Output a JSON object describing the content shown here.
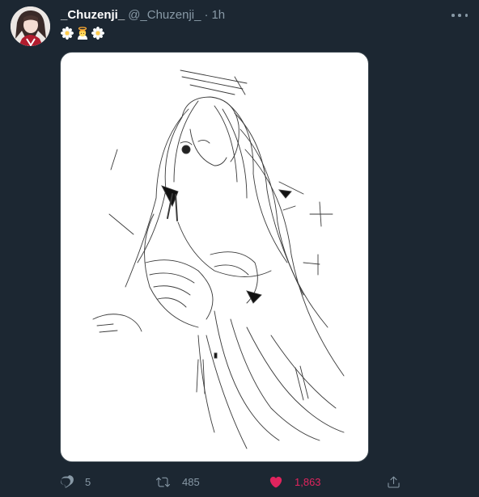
{
  "tweet": {
    "display_name": "_Chuzenji_",
    "handle": "@_Chuzenji_",
    "separator": "·",
    "time": "1h",
    "text_emojis": [
      "daisy-emoji",
      "angel-emoji",
      "daisy-emoji"
    ],
    "media_alt": "line-art-sketch",
    "like_color": "#e0245e"
  },
  "actions": {
    "reply_count": "5",
    "retweet_count": "485",
    "like_count": "1,863",
    "liked": true
  },
  "icons": {
    "more": "more-options-icon",
    "reply": "reply-icon",
    "retweet": "retweet-icon",
    "like": "heart-icon",
    "share": "share-icon"
  }
}
